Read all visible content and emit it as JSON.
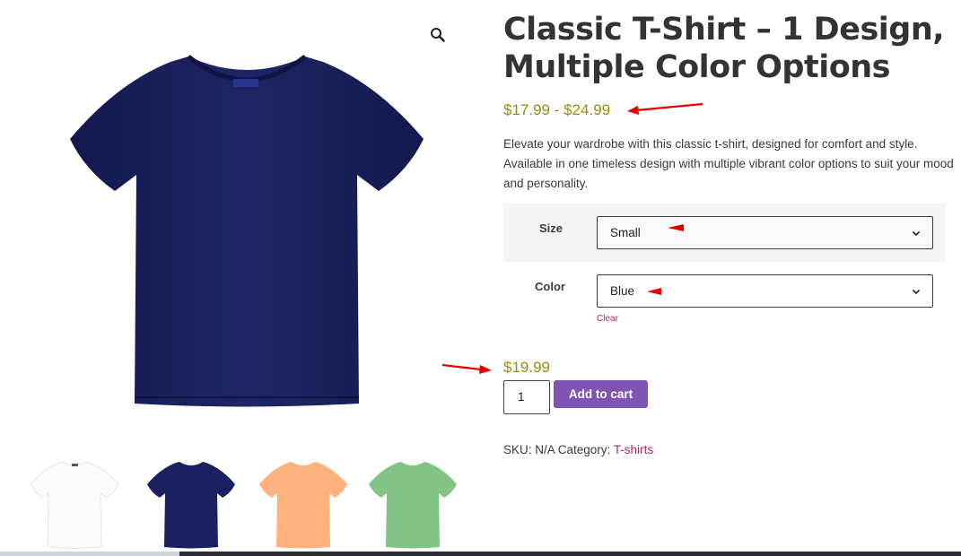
{
  "product": {
    "title": "Classic T-Shirt – 1 Design, Multiple Color Options",
    "price_range": "$17.99 - $24.99",
    "description": "Elevate your wardrobe with this classic t-shirt, designed for comfort and style. Available in one timeless design with multiple vibrant color options to suit your mood and personality.",
    "variations": {
      "size_label": "Size",
      "size_value": "Small",
      "color_label": "Color",
      "color_value": "Blue",
      "clear_label": "Clear"
    },
    "variation_price": "$19.99",
    "quantity": "1",
    "add_to_cart_label": "Add to cart",
    "meta": {
      "sku_text": "SKU: N/A Category: ",
      "category_link": "T-shirts"
    }
  },
  "gallery": {
    "main_image_color": "#1b2160",
    "thumbnails": [
      {
        "name": "white",
        "color": "#ffffff"
      },
      {
        "name": "navy",
        "color": "#1b2160"
      },
      {
        "name": "peach",
        "color": "#ffb27d"
      },
      {
        "name": "green",
        "color": "#82c486"
      }
    ]
  },
  "colors": {
    "price": "#958e09",
    "button": "#7f54b3",
    "link": "#b0255f",
    "annotation_arrow": "#e30000"
  },
  "icons": {
    "zoom": "magnifier-icon",
    "select_chevron": "chevron-down-icon"
  }
}
